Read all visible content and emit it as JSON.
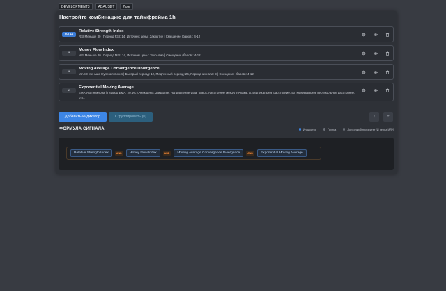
{
  "tabs": [
    "DEVELOPMENT3",
    "ADAUSDT",
    "Лонг"
  ],
  "panel": {
    "title": "Настройте комбинацию для таймфрейма 1h"
  },
  "indicators": [
    {
      "badge": "КОГДА",
      "name": "Relative Strength Index",
      "desc": "RSI Меньше 30 | Период RSI: 14, Источник цены: Закрытие | Смещение (баров): 4-12"
    },
    {
      "badge": "И",
      "name": "Money Flow Index",
      "desc": "MFI Меньше 20 | Период MFI: 14, Источник цены: Закрытие | Смещение (баров): 4-12"
    },
    {
      "badge": "И",
      "name": "Moving Average Convergence Divergence",
      "desc": "MACD Меньше Нулевая линия | Быстрый период: 12, Медленный период: 26, Период сигнала: 9 | Смещение (баров): 4-12"
    },
    {
      "badge": "И",
      "name": "Exponential Moving Average",
      "desc": "EMA Угол наклона | Период EMA: 20, Источник цены: Закрытие, Направление угла: Вверх, Расстояние между точками: 5, Вертикальное расстояние: 50, Минимальное вертикальное расстояние: 0.01"
    }
  ],
  "buttons": {
    "add": "Добавить индикатор",
    "group": "Сгруппировать (0)",
    "up": "↑",
    "down": "+"
  },
  "formula": {
    "title": "ФОРМУЛА СИГНАЛА",
    "legend": [
      "Индикатор",
      "Группа",
      "Логический приоритет (И перед ИЛИ)"
    ],
    "chips": [
      "Relative Strength Index",
      "Money Flow Index",
      "Moving Average Convergence Divergence",
      "Exponential Moving Average"
    ],
    "op": "AND"
  },
  "colors": {
    "accent": "#3d86e6",
    "operator": "#ff8f3a"
  }
}
